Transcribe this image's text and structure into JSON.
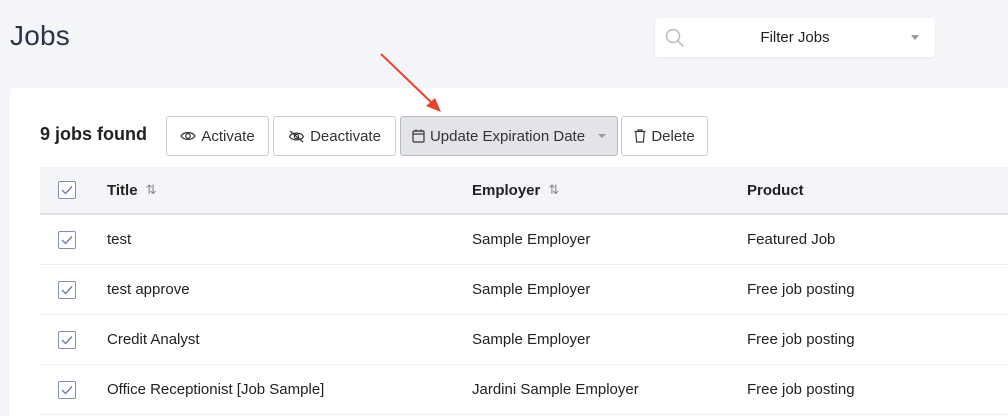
{
  "page": {
    "title": "Jobs"
  },
  "filter": {
    "label": "Filter Jobs"
  },
  "results": {
    "count_label": "9 jobs found"
  },
  "toolbar": {
    "activate_label": "Activate",
    "deactivate_label": "Deactivate",
    "update_label": "Update Expiration Date",
    "delete_label": "Delete"
  },
  "table": {
    "headers": {
      "title": "Title",
      "employer": "Employer",
      "product": "Product"
    },
    "rows": [
      {
        "title": "test",
        "employer": "Sample Employer",
        "product": "Featured Job"
      },
      {
        "title": "test approve",
        "employer": "Sample Employer",
        "product": "Free job posting"
      },
      {
        "title": "Credit Analyst",
        "employer": "Sample Employer",
        "product": "Free job posting"
      },
      {
        "title": "Office Receptionist [Job Sample]",
        "employer": "Jardini Sample Employer",
        "product": "Free job posting"
      }
    ]
  },
  "colors": {
    "accent": "#8390b2",
    "annotation_arrow": "#e8432d",
    "background": "#f4f5f9"
  },
  "icons": [
    "search-icon",
    "eye-icon",
    "eye-slash-icon",
    "calendar-icon",
    "trash-icon",
    "sort-icon",
    "check-icon",
    "chevron-down-icon"
  ]
}
